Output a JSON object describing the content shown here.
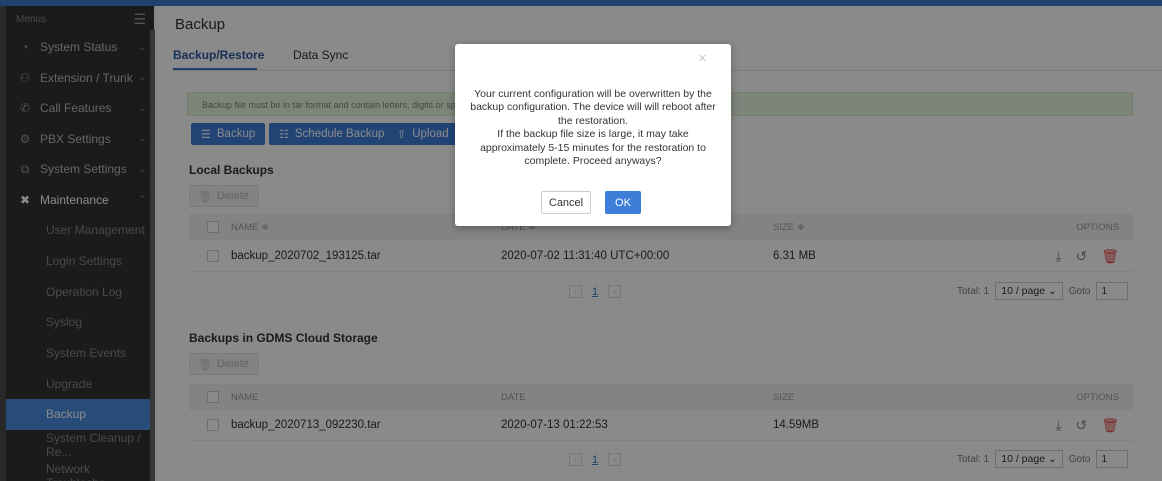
{
  "sidebar": {
    "menus_label": "Menus",
    "items": [
      {
        "label": "System Status",
        "icon": "gauge-icon"
      },
      {
        "label": "Extension / Trunk",
        "icon": "network-icon"
      },
      {
        "label": "Call Features",
        "icon": "phone-icon"
      },
      {
        "label": "PBX Settings",
        "icon": "gear-icon"
      },
      {
        "label": "System Settings",
        "icon": "settings-panel-icon"
      },
      {
        "label": "Maintenance",
        "icon": "tools-icon"
      }
    ],
    "subitems": [
      {
        "label": "User Management"
      },
      {
        "label": "Login Settings"
      },
      {
        "label": "Operation Log"
      },
      {
        "label": "Syslog"
      },
      {
        "label": "System Events"
      },
      {
        "label": "Upgrade"
      },
      {
        "label": "Backup"
      },
      {
        "label": "System Cleanup / Re..."
      },
      {
        "label": "Network Troublesho..."
      }
    ]
  },
  "header": {
    "title": "Backup"
  },
  "tabs": [
    {
      "label": "Backup/Restore"
    },
    {
      "label": "Data Sync"
    }
  ],
  "notice": "Backup file must be in tar format and contain letters, digits or spec",
  "toolbar": {
    "backup": "Backup",
    "schedule": "Schedule Backup",
    "upload": "Upload"
  },
  "local": {
    "title": "Local Backups",
    "delete": "Delete",
    "headers": {
      "name": "NAME ≑",
      "date": "DATE ≑",
      "size": "SIZE ≑",
      "options": "OPTIONS"
    },
    "rows": [
      {
        "name": "backup_2020702_193125.tar",
        "date": "2020-07-02 11:31:40 UTC+00:00",
        "size": "6.31 MB"
      }
    ],
    "page": "1",
    "total": "Total: 1",
    "per_page": "10 / page",
    "goto": "Goto",
    "goto_value": "1"
  },
  "cloud": {
    "title": "Backups in GDMS Cloud Storage",
    "delete": "Delete",
    "headers": {
      "name": "NAME",
      "date": "DATE",
      "size": "SIZE",
      "options": "OPTIONS"
    },
    "rows": [
      {
        "name": "backup_2020713_092230.tar",
        "date": "2020-07-13 01:22:53",
        "size": "14.59MB"
      }
    ],
    "page": "1",
    "total": "Total: 1",
    "per_page": "10 / page",
    "goto": "Goto",
    "goto_value": "1"
  },
  "modal": {
    "lines": [
      "Your current configuration will be overwritten by the",
      "backup configuration. The device will will reboot after",
      "the restoration.",
      "If the backup file size is large, it may take",
      "approximately 5-15 minutes for the restoration to",
      "complete. Proceed anyways?"
    ],
    "cancel": "Cancel",
    "ok": "OK"
  },
  "colors": {
    "accent": "#3d7ed8",
    "sidebar_bg": "#333333",
    "active_item": "#4a8de0",
    "danger": "#e64a4a",
    "notice_bg": "#e7f4e1"
  }
}
